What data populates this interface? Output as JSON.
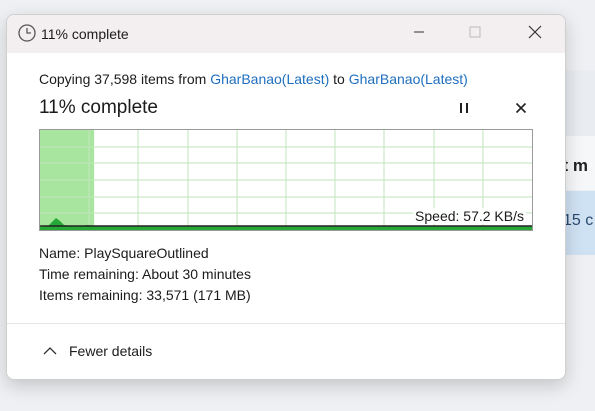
{
  "background": {
    "header_fragment": "st m",
    "row_fragment": "15 c"
  },
  "window": {
    "title": "11% complete",
    "icons": {
      "app": "clock-icon",
      "minimize": "minimize-icon",
      "maximize": "maximize-icon",
      "close": "close-icon"
    }
  },
  "operation": {
    "prefix": "Copying 37,598 items from ",
    "source": "GharBanao(Latest)",
    "joiner": " to ",
    "destination": "GharBanao(Latest)"
  },
  "status": {
    "title": "11% complete",
    "progress_fraction": 0.11,
    "pause_icon": "pause-icon",
    "stop_icon": "close-icon",
    "speed": "Speed: 57.2 KB/s"
  },
  "details": {
    "name_label": "Name:",
    "name_value": "PlaySquareOutlined",
    "time_label": "Time remaining:",
    "time_value": "About 30 minutes",
    "items_label": "Items remaining:",
    "items_value": "33,571 (171 MB)"
  },
  "footer": {
    "toggle_label": "Fewer details",
    "toggle_icon": "chevron-up-icon"
  },
  "colors": {
    "accent": "#1f6fbf",
    "progress_fill": "#a8e6a0",
    "speed_graph": "#26a836",
    "grid": "#bfe6bd"
  }
}
